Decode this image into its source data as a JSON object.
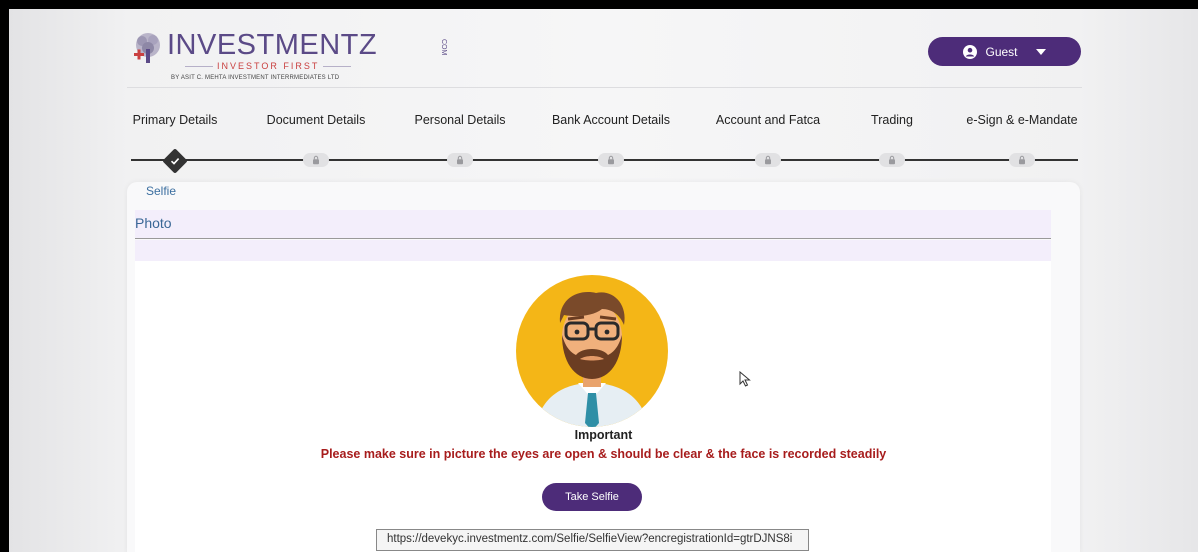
{
  "brand": {
    "name": "INVESTMENTZ",
    "com": "COM",
    "tagline": "INVESTOR FIRST",
    "sub": "BY ASIT C. MEHTA INVESTMENT INTERRMEDIATES LTD"
  },
  "user_menu": {
    "label": "Guest",
    "icon": "user-circle-icon"
  },
  "steps": [
    {
      "label": "Primary Details",
      "state": "completed"
    },
    {
      "label": "Document Details",
      "state": "locked"
    },
    {
      "label": "Personal Details",
      "state": "locked"
    },
    {
      "label": "Bank Account Details",
      "state": "locked"
    },
    {
      "label": "Account and Fatca",
      "state": "locked"
    },
    {
      "label": "Trading",
      "state": "locked"
    },
    {
      "label": "e-Sign & e-Mandate",
      "state": "locked"
    }
  ],
  "section": {
    "title": "Selfie",
    "panel_title": "Photo",
    "important_label": "Important",
    "warning": "Please make sure in picture the eyes are open & should be clear & the face is recorded steadily",
    "take_selfie_label": "Take Selfie",
    "status_url": "https://devekyc.investmentz.com/Selfie/SelfieView?encregistrationId=gtrDJNS8i"
  },
  "colors": {
    "brand_purple": "#4d2c79",
    "warning_red": "#a71c1c",
    "panel_tint": "#f3eefb"
  }
}
